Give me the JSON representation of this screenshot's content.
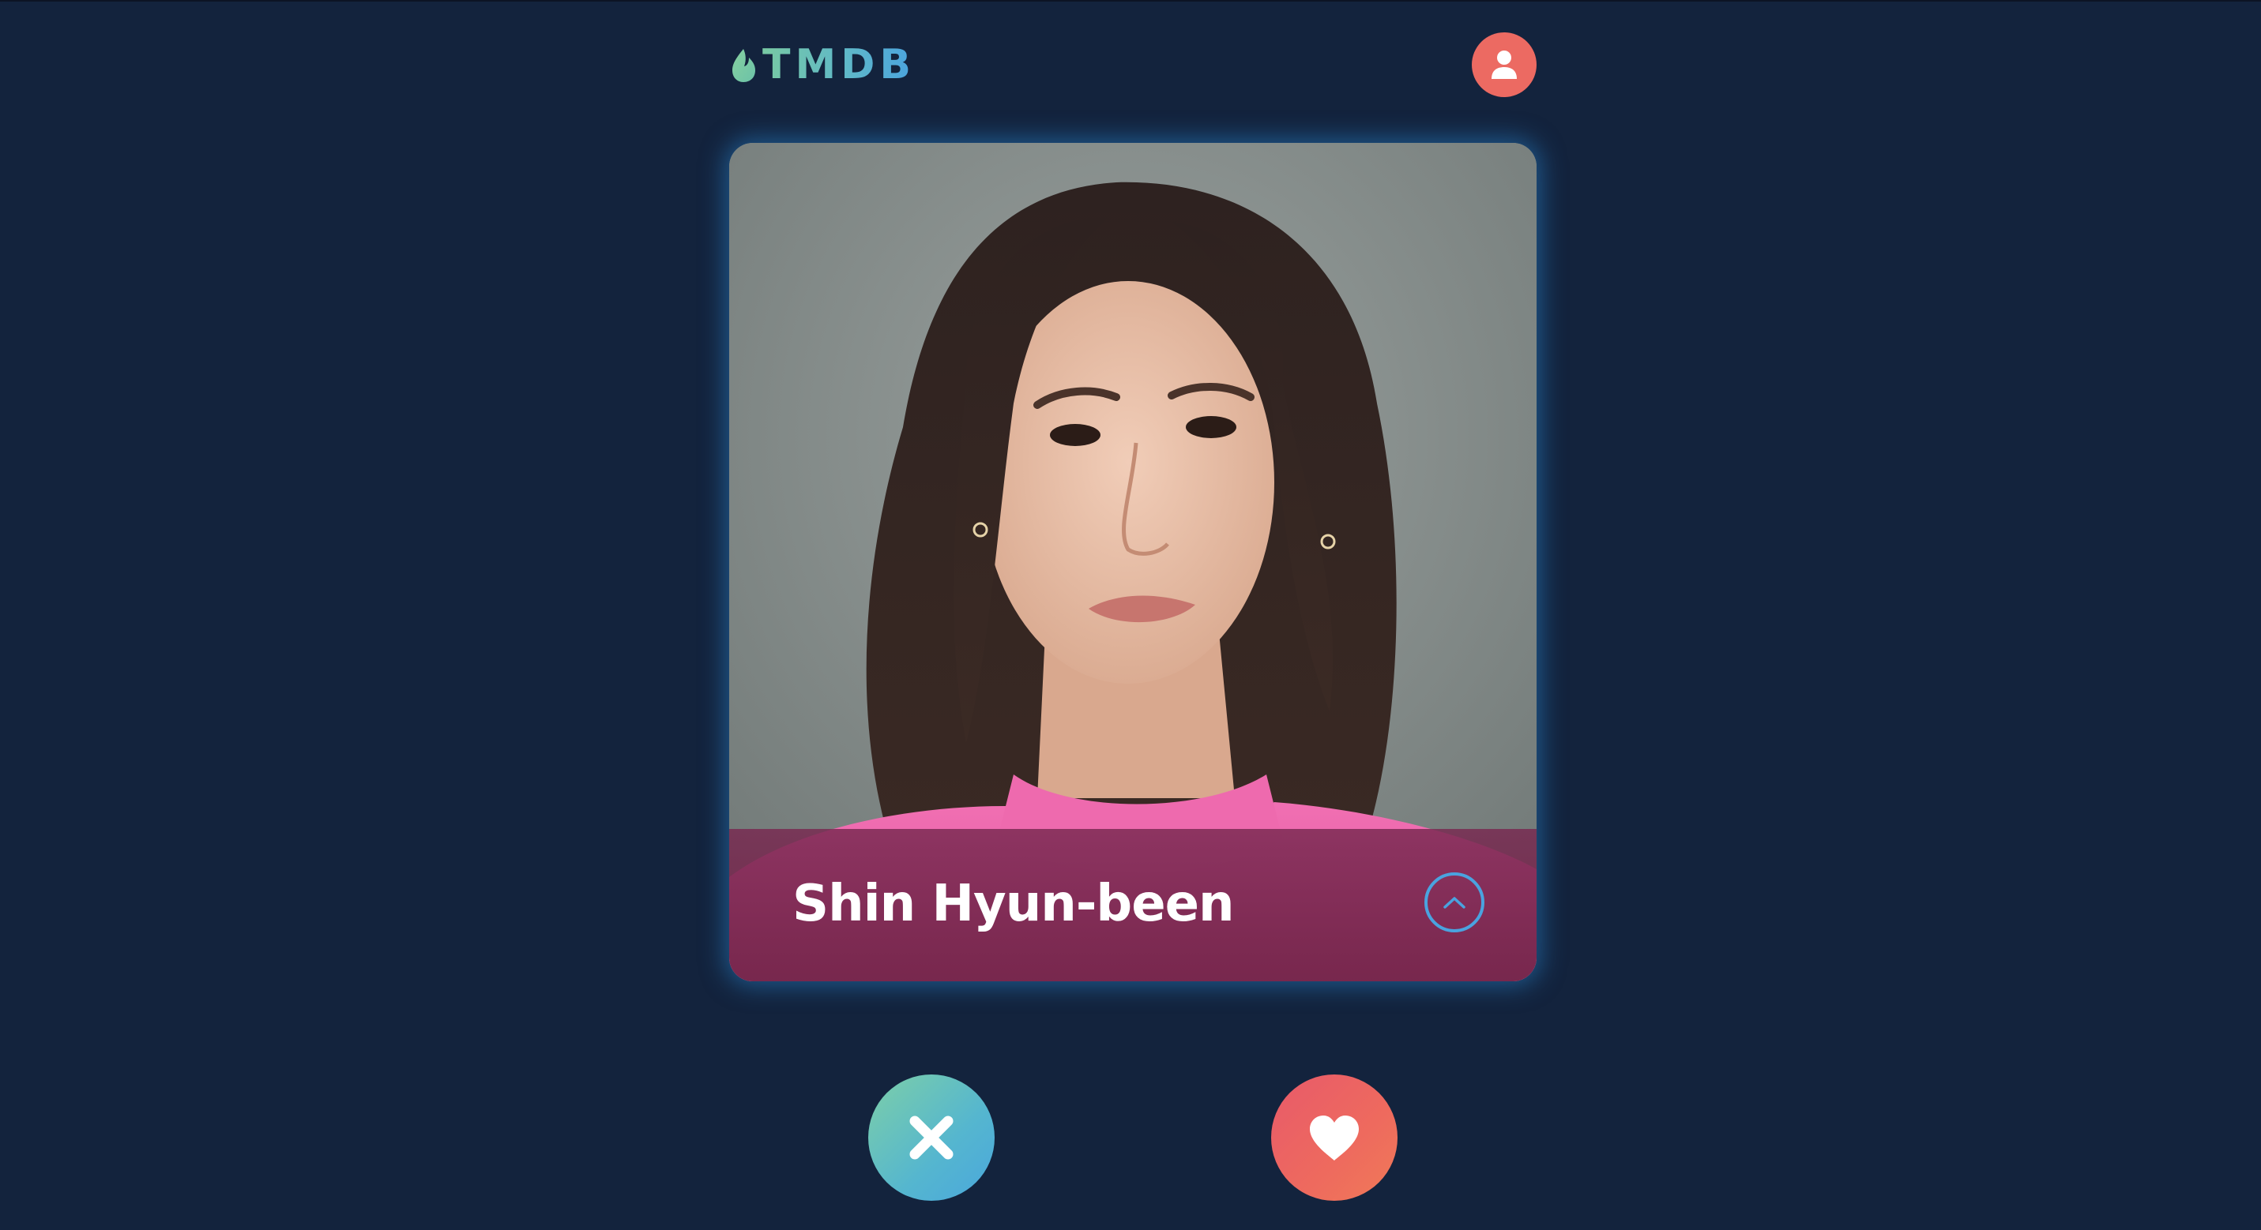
{
  "header": {
    "logo_text": "TMDB",
    "logo_icon": "flame-icon",
    "profile_icon": "user-icon"
  },
  "card": {
    "name": "Shin Hyun-been",
    "expand_icon": "chevron-up-icon"
  },
  "actions": {
    "dislike_icon": "close-icon",
    "like_icon": "heart-icon"
  },
  "colors": {
    "background": "#13233d",
    "accent_red": "#ec6a62",
    "accent_teal": "#5fb8c9",
    "accent_blue": "#4aa3df"
  }
}
